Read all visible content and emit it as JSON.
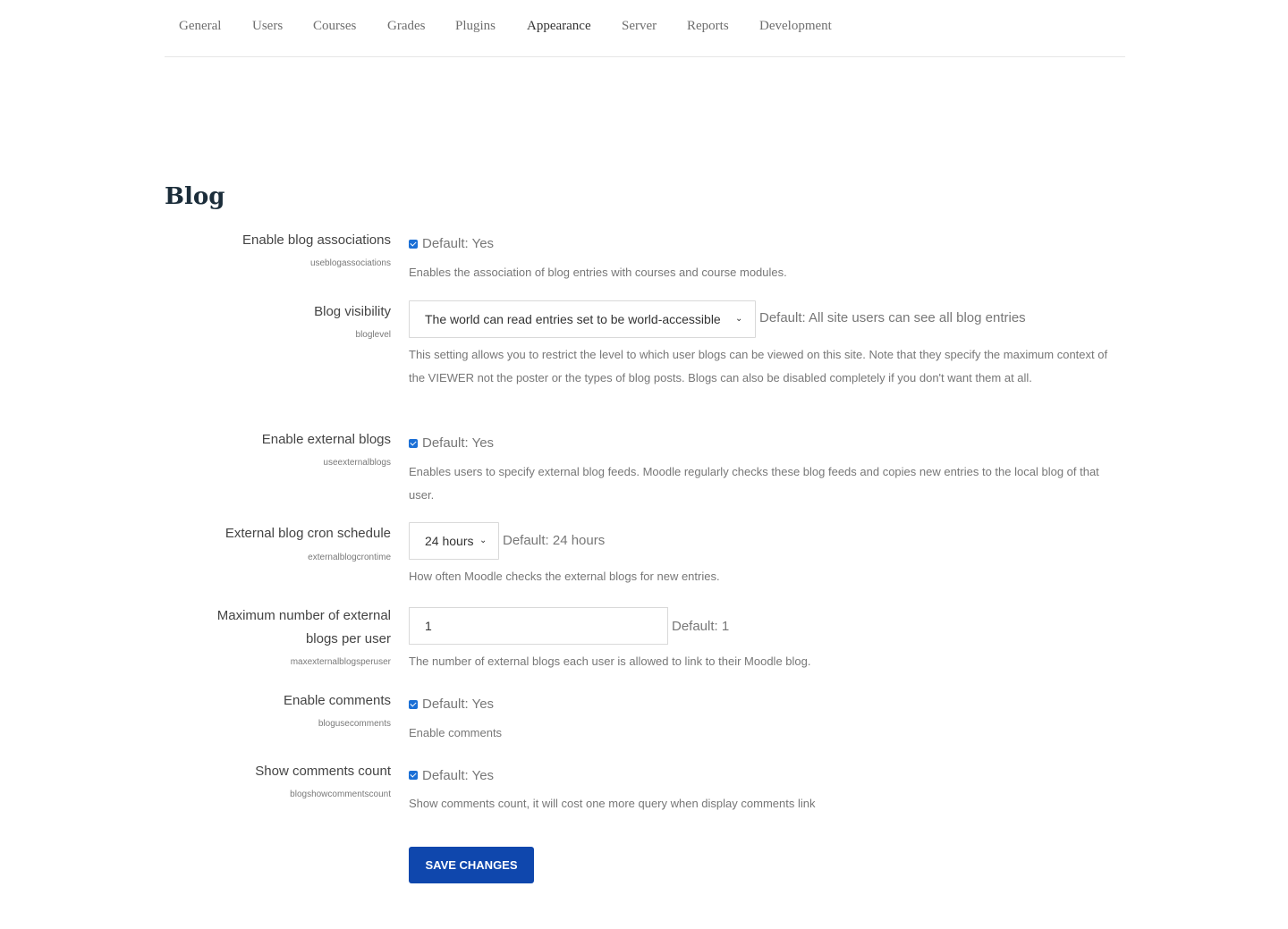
{
  "tabs": [
    "General",
    "Users",
    "Courses",
    "Grades",
    "Plugins",
    "Appearance",
    "Server",
    "Reports",
    "Development"
  ],
  "active_tab": "Appearance",
  "section_title": "Blog",
  "settings": {
    "associations": {
      "label": "Enable blog associations",
      "key": "useblogassociations",
      "checked": true,
      "default": "Default: Yes",
      "description": "Enables the association of blog entries with courses and course modules."
    },
    "visibility": {
      "label": "Blog visibility",
      "key": "bloglevel",
      "selected": "The world can read entries set to be world-accessible",
      "default": "Default: All site users can see all blog entries",
      "description": "This setting allows you to restrict the level to which user blogs can be viewed on this site. Note that they specify the maximum context of the VIEWER not the poster or the types of blog posts. Blogs can also be disabled completely if you don't want them at all."
    },
    "external": {
      "label": "Enable external blogs",
      "key": "useexternalblogs",
      "checked": true,
      "default": "Default: Yes",
      "description": "Enables users to specify external blog feeds. Moodle regularly checks these blog feeds and copies new entries to the local blog of that user."
    },
    "cron": {
      "label": "External blog cron schedule",
      "key": "externalblogcrontime",
      "selected": "24 hours",
      "default": "Default: 24 hours",
      "description": "How often Moodle checks the external blogs for new entries."
    },
    "max": {
      "label": "Maximum number of external blogs per user",
      "key": "maxexternalblogsperuser",
      "value": "1",
      "default": "Default: 1",
      "description": "The number of external blogs each user is allowed to link to their Moodle blog."
    },
    "comments": {
      "label": "Enable comments",
      "key": "blogusecomments",
      "checked": true,
      "default": "Default: Yes",
      "description": "Enable comments"
    },
    "count": {
      "label": "Show comments count",
      "key": "blogshowcommentscount",
      "checked": true,
      "default": "Default: Yes",
      "description": "Show comments count, it will cost one more query when display comments link"
    }
  },
  "save_label": "SAVE CHANGES",
  "colors": {
    "accent": "#0f47ad",
    "checkbox": "#1a6fd6"
  }
}
